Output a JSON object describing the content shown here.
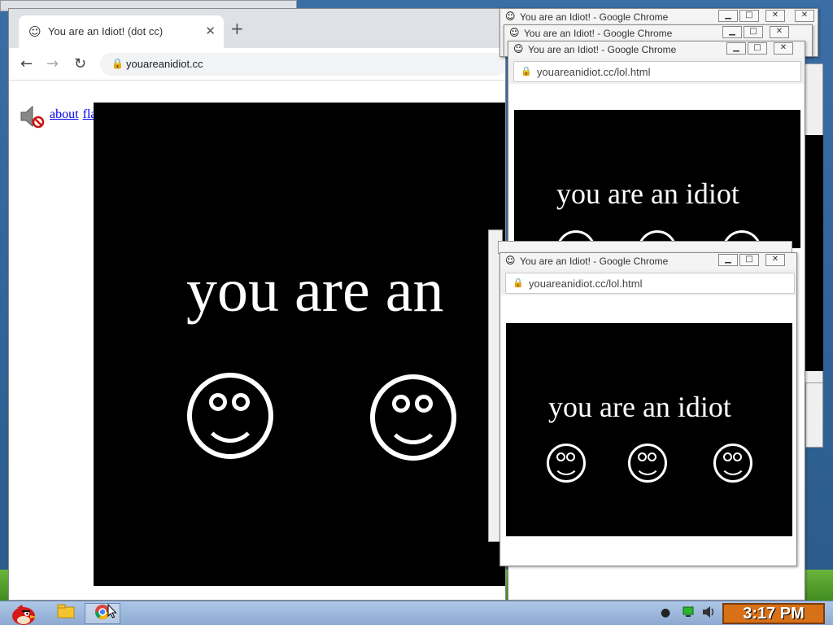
{
  "desktop": {
    "bg_color": "#3a6ea5"
  },
  "main_window": {
    "tab_title": "You are an Idiot! (dot cc)",
    "tab_icon": "smiley-icon",
    "url": "youareanidiot.cc",
    "links": [
      "about",
      "flash"
    ],
    "sound_icon": "speaker-muted-icon",
    "big_text": "you are an"
  },
  "popups": [
    {
      "title": "You are an Idiot! - Google Chrome",
      "url": "youareanidiot.cc/lol.html",
      "text": "you are an idiot"
    },
    {
      "title": "You are an Idiot! - Google Chrome"
    },
    {
      "title": "You are an Idiot! - Google Chrome"
    },
    {
      "title": "You are an Idiot! - Google Chrome",
      "url": "youareanidiot.cc/lol.html",
      "text": "you are an idiot"
    }
  ],
  "taskbar": {
    "clock": "3:17 PM",
    "clock_color": "#d87018"
  }
}
